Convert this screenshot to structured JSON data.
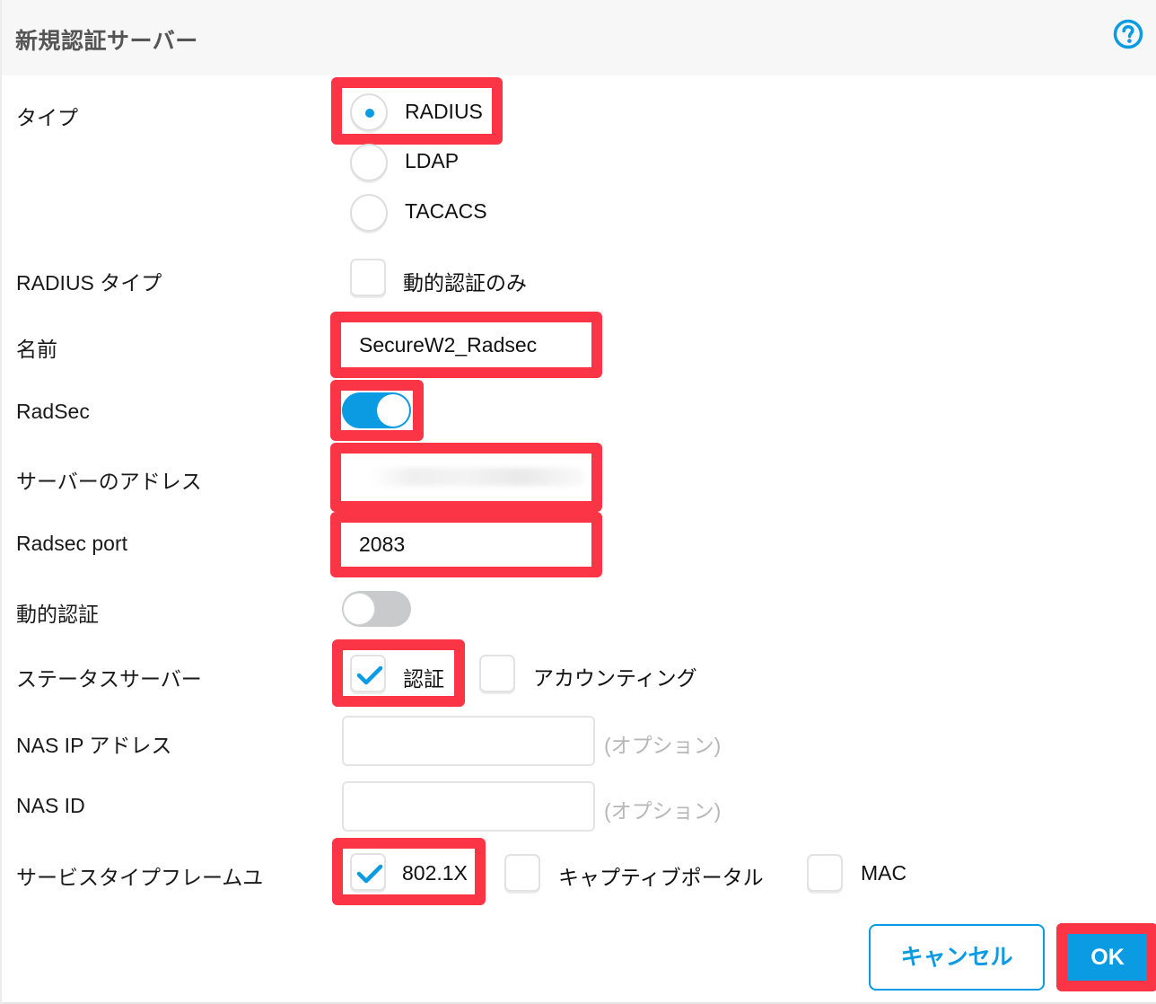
{
  "dialog": {
    "title": "新規認証サーバー",
    "help_icon": "question-circle-icon"
  },
  "fields": {
    "type": {
      "label": "タイプ",
      "options": [
        "RADIUS",
        "LDAP",
        "TACACS"
      ],
      "selected": "RADIUS"
    },
    "radius_type": {
      "label": "RADIUS タイプ",
      "checkbox_label": "動的認証のみ",
      "checked": false
    },
    "name": {
      "label": "名前",
      "value": "SecureW2_Radsec"
    },
    "radsec": {
      "label": "RadSec",
      "enabled": true
    },
    "server_address": {
      "label": "サーバーのアドレス",
      "value": ""
    },
    "radsec_port": {
      "label": "Radsec port",
      "value": "2083"
    },
    "dynamic_auth": {
      "label": "動的認証",
      "enabled": false
    },
    "status_server": {
      "label": "ステータスサーバー",
      "options": [
        {
          "label": "認証",
          "checked": true
        },
        {
          "label": "アカウンティング",
          "checked": false
        }
      ]
    },
    "nas_ip": {
      "label": "NAS IP アドレス",
      "value": "",
      "hint": "(オプション)"
    },
    "nas_id": {
      "label": "NAS ID",
      "value": "",
      "hint": "(オプション)"
    },
    "service_type": {
      "label": "サービスタイプフレームユ",
      "options": [
        {
          "label": "802.1X",
          "checked": true
        },
        {
          "label": "キャプティブポータル",
          "checked": false
        },
        {
          "label": "MAC",
          "checked": false
        }
      ]
    }
  },
  "buttons": {
    "cancel": "キャンセル",
    "ok": "OK"
  },
  "colors": {
    "accent": "#0a9be3",
    "highlight": "#fb3545",
    "toggle_off": "#c8cacc",
    "hint_text": "#b8b8b8"
  }
}
